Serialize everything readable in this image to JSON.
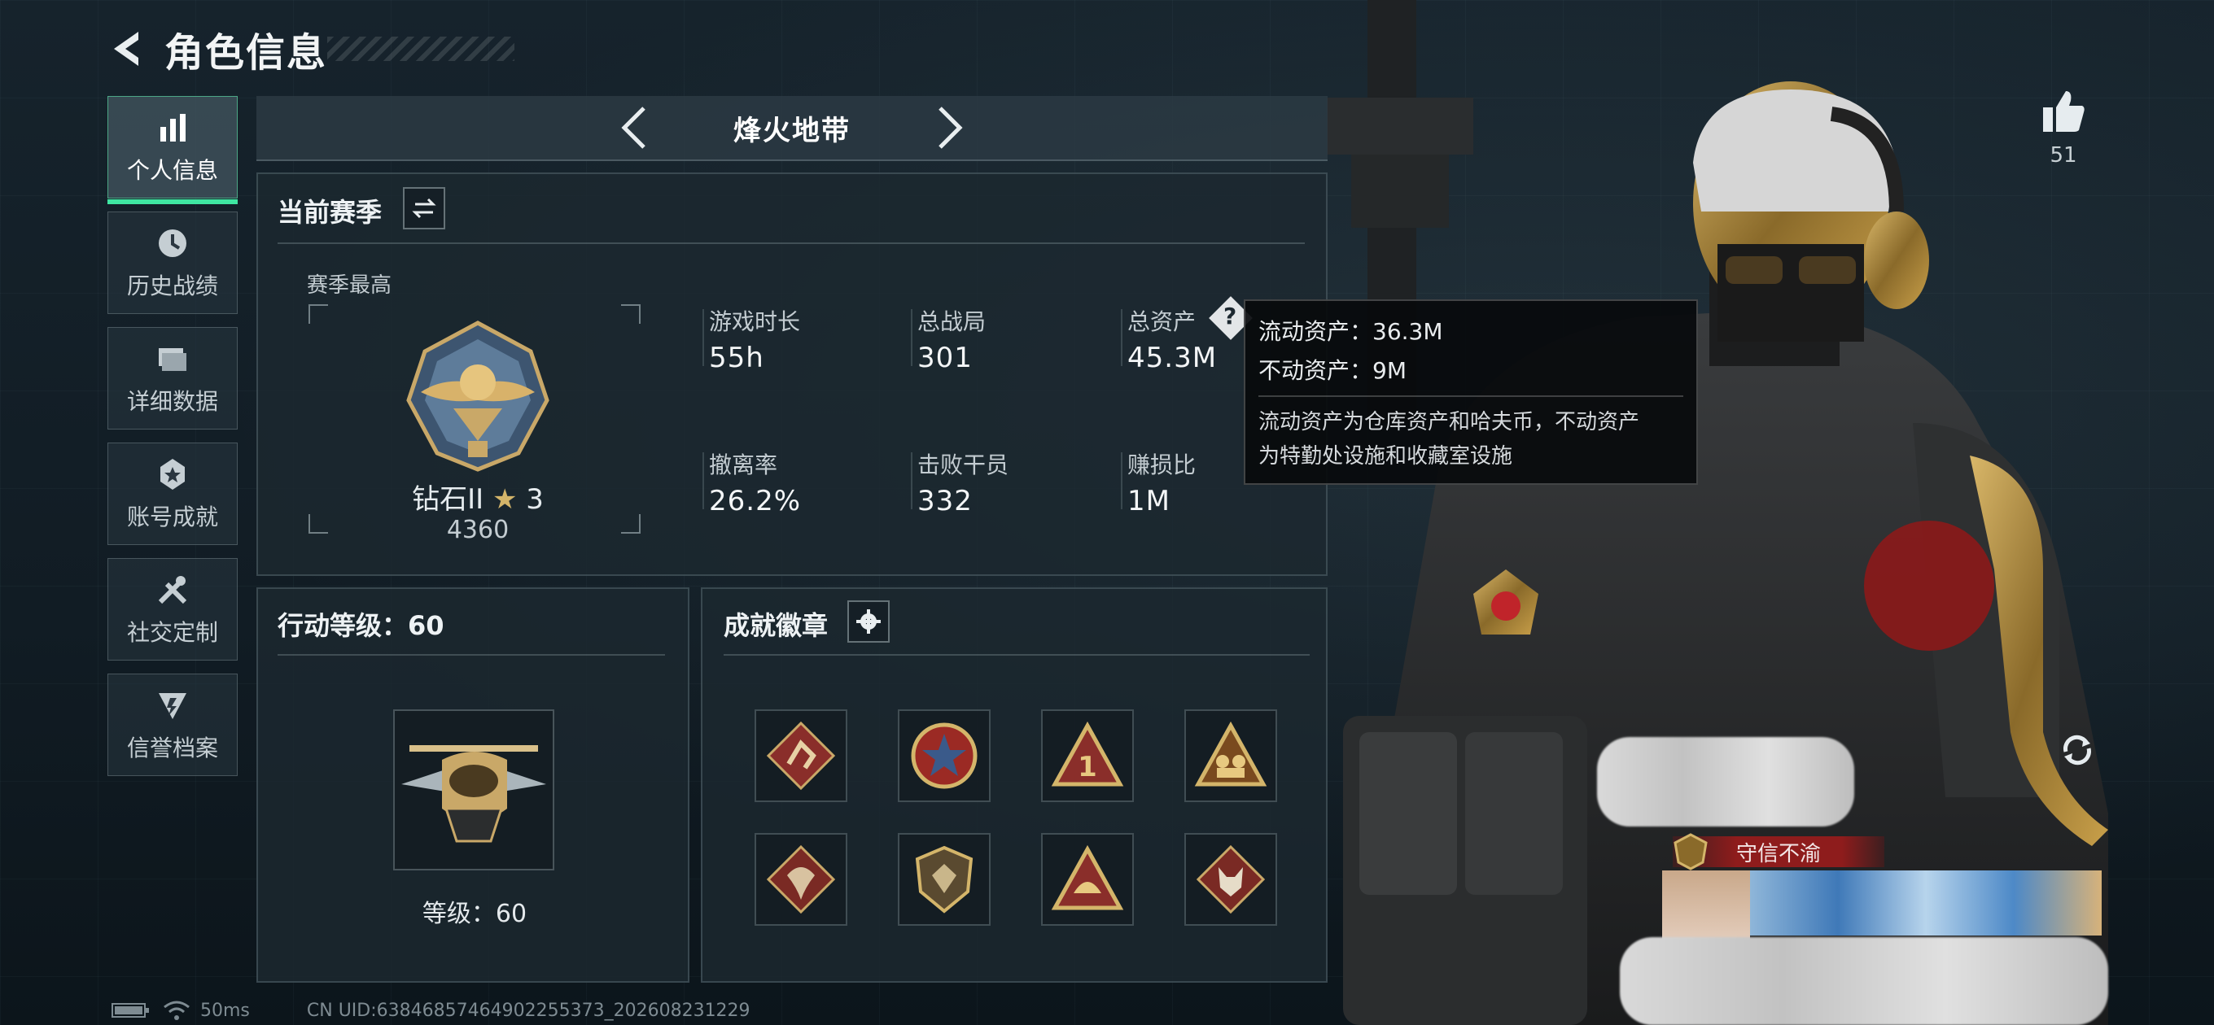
{
  "header": {
    "title": "角色信息"
  },
  "sidebar": {
    "items": [
      {
        "label": "个人信息",
        "icon": "bar-chart-icon",
        "active": true
      },
      {
        "label": "历史战绩",
        "icon": "clock-icon",
        "active": false
      },
      {
        "label": "详细数据",
        "icon": "folder-icon",
        "active": false
      },
      {
        "label": "账号成就",
        "icon": "medal-icon",
        "active": false
      },
      {
        "label": "社交定制",
        "icon": "tools-icon",
        "active": false
      },
      {
        "label": "信誉档案",
        "icon": "shield-icon",
        "active": false
      }
    ]
  },
  "mode_tab": {
    "title": "烽火地带"
  },
  "season": {
    "title": "当前赛季",
    "highest_label": "赛季最高",
    "rank_name": "钻石II",
    "rank_stars": "3",
    "rank_score": "4360",
    "stats": [
      {
        "label": "游戏时长",
        "value": "55h"
      },
      {
        "label": "总战局",
        "value": "301"
      },
      {
        "label": "总资产",
        "value": "45.3M"
      },
      {
        "label": "撤离率",
        "value": "26.2%"
      },
      {
        "label": "击败干员",
        "value": "332"
      },
      {
        "label": "赚损比",
        "value": "1M"
      }
    ]
  },
  "tooltip": {
    "liquid": "流动资产：36.3M",
    "fixed": "不动资产：9M",
    "note_line1": "流动资产为仓库资产和哈夫币，不动资产",
    "note_line2": "为特勤处设施和收藏室设施"
  },
  "level_panel": {
    "title": "行动等级：60",
    "level_text": "等级：60"
  },
  "achievements": {
    "title": "成就徽章",
    "badges": [
      "sprint-badge-icon",
      "star-wheel-badge-icon",
      "number-one-badge-icon",
      "squad-badge-icon",
      "dragon-badge-icon",
      "gem-shield-badge-icon",
      "helmet-badge-icon",
      "wolf-badge-icon"
    ]
  },
  "profile": {
    "like_count": "51",
    "title_tag": "守信不渝"
  },
  "footer": {
    "ping": "50ms",
    "uid": "CN UID:6384685746490225​5373_202608231229"
  },
  "colors": {
    "accent": "#3fe6a2",
    "title_tag": "#8e1c1c",
    "panel": "#1c2830"
  }
}
